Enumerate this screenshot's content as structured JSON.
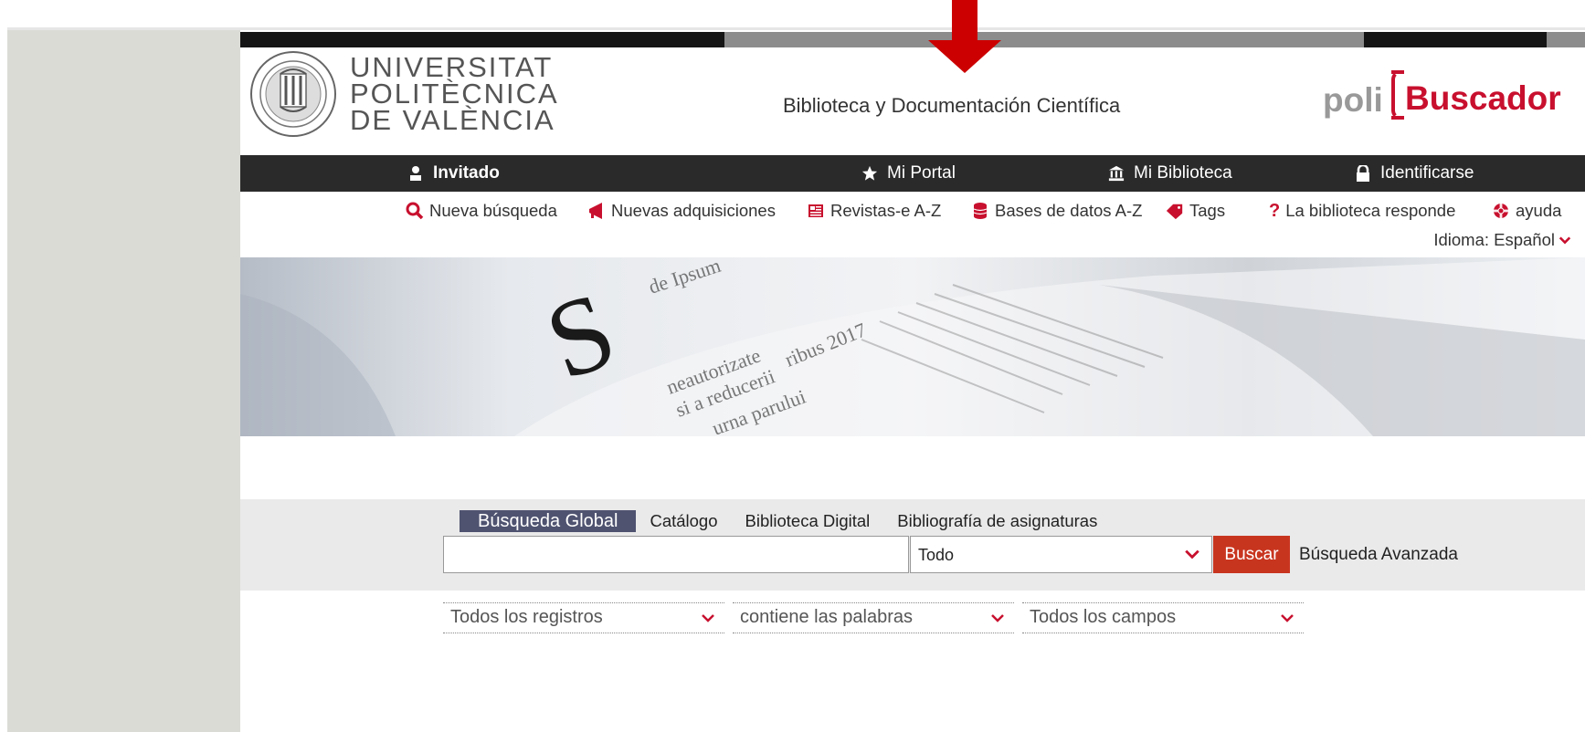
{
  "header": {
    "logo_lines": [
      "UNIVERSITAT",
      "POLITÈCNICA",
      "DE VALÈNCIA"
    ],
    "site_title": "Biblioteca y Documentación Científica",
    "brand_prefix": "poli",
    "brand_word": "Buscador",
    "brand_color": "#c8102e"
  },
  "navbar": {
    "user": "Invitado",
    "portal": "Mi Portal",
    "library": "Mi Biblioteca",
    "login": "Identificarse"
  },
  "toolbar": {
    "new_search": "Nueva búsqueda",
    "new_acquisitions": "Nuevas adquisiciones",
    "ejournals": "Revistas-e A-Z",
    "databases": "Bases de datos A-Z",
    "tags": "Tags",
    "ask_library": "La biblioteca responde",
    "help": "ayuda",
    "language_label": "Idioma: Español"
  },
  "search": {
    "tabs": [
      "Búsqueda Global",
      "Catálogo",
      "Biblioteca Digital",
      "Bibliografía de asignaturas"
    ],
    "active_tab": "Búsqueda Global",
    "query": "",
    "scope": "Todo",
    "button": "Buscar",
    "advanced": "Búsqueda Avanzada"
  },
  "filters": {
    "records": "Todos los registros",
    "operator": "contiene las palabras",
    "fields": "Todos los campos"
  },
  "icons": {
    "user": "user-icon",
    "portal": "star-icon",
    "library": "bank-icon",
    "login": "lock-icon",
    "search": "search-icon",
    "megaphone": "megaphone-icon",
    "newspaper": "newspaper-icon",
    "database": "database-icon",
    "tag": "tag-icon",
    "question": "question-icon",
    "lifebuoy": "lifebuoy-icon"
  }
}
